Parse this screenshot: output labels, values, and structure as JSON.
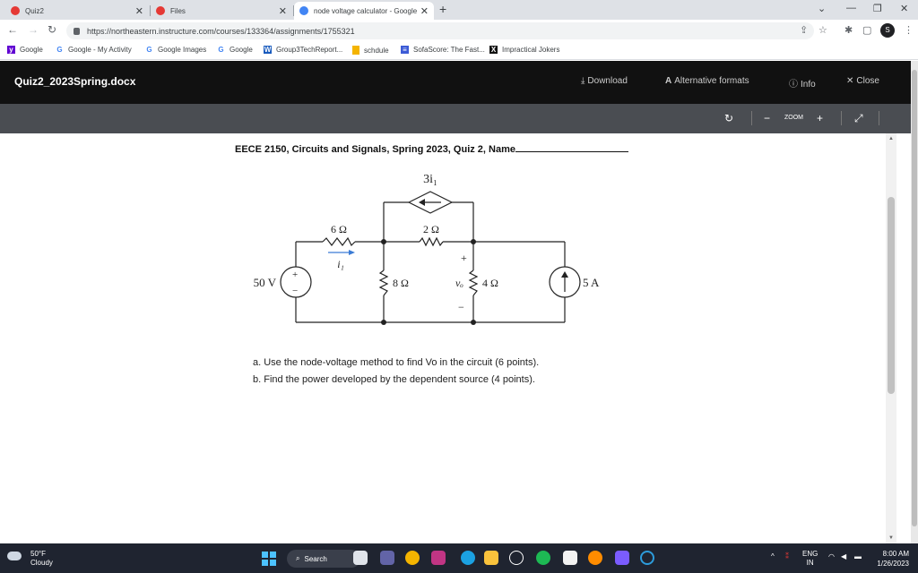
{
  "browser": {
    "tabs": [
      {
        "title": "Quiz2",
        "fav_color": "#e53935"
      },
      {
        "title": "Files",
        "fav_color": "#e53935"
      },
      {
        "title": "node voltage calculator - Google",
        "fav_color": "#4285f4"
      }
    ],
    "url": "https://northeastern.instructure.com/courses/133364/assignments/1755321",
    "avatar": "S",
    "bookmarks": [
      {
        "label": "Google",
        "icon": "Y",
        "color": "#6001d2"
      },
      {
        "label": "Google - My Activity",
        "icon": "G",
        "color": "#4285f4"
      },
      {
        "label": "Google Images",
        "icon": "G",
        "color": "#4285f4"
      },
      {
        "label": "Google",
        "icon": "G",
        "color": "#4285f4"
      },
      {
        "label": "Group3TechReport...",
        "icon": "W",
        "color": "#185abd"
      },
      {
        "label": "schdule",
        "icon": "",
        "color": "#f4b400"
      },
      {
        "label": "SofaScore: The Fast...",
        "icon": "S",
        "color": "#3c5bd6"
      },
      {
        "label": "Impractical Jokers",
        "icon": "X",
        "color": "#111"
      }
    ]
  },
  "viewer": {
    "doc_title": "Quiz2_2023Spring.docx",
    "download": "Download",
    "alt_formats": "Alternative formats",
    "info": "Info",
    "close": "Close",
    "zoom_label": "ZOOM"
  },
  "document": {
    "header": "EECE 2150, Circuits and Signals, Spring 2023, Quiz 2, Name",
    "question_a": "a.  Use the node-voltage method to find Vo in the circuit (6 points).",
    "question_b": "b.  Find the power developed by the dependent source (4 points).",
    "circuit": {
      "dep_source": "3i₁",
      "r6": "6 Ω",
      "r2": "2 Ω",
      "r8": "8 Ω",
      "r4": "4 Ω",
      "v_source": "50 V",
      "i_source": "5 A",
      "current_label": "i₁",
      "vo_label": "vₒ",
      "plus": "+",
      "minus": "−"
    }
  },
  "taskbar": {
    "temp": "50°F",
    "weather": "Cloudy",
    "search": "Search",
    "lang1": "ENG",
    "lang2": "IN",
    "time": "8:00 AM",
    "date": "1/26/2023"
  }
}
